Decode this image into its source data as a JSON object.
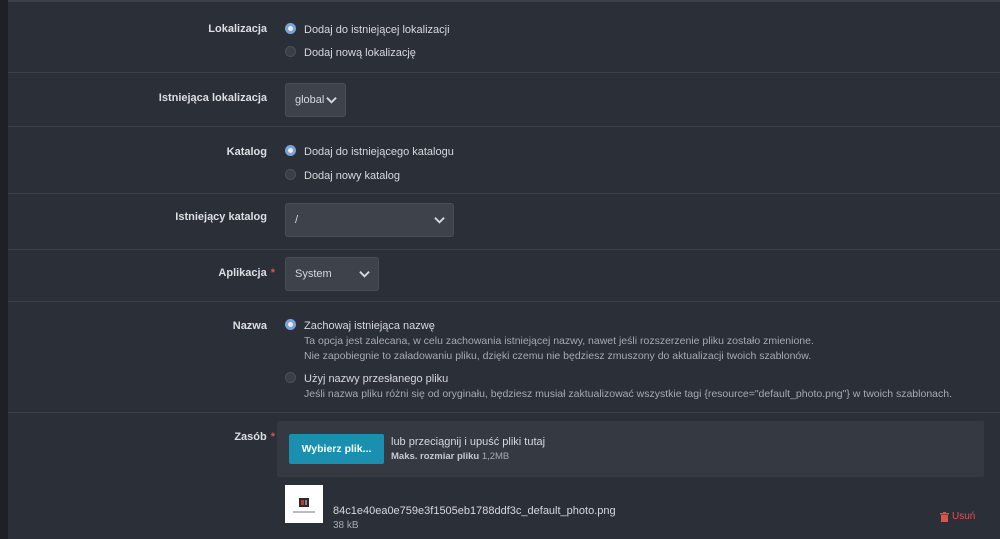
{
  "lokalizacja": {
    "label": "Lokalizacja",
    "options": [
      {
        "label": "Dodaj do istniejącej lokalizacji",
        "selected": true
      },
      {
        "label": "Dodaj nową lokalizację",
        "selected": false
      }
    ]
  },
  "istniejaca_lokalizacja": {
    "label": "Istniejąca lokalizacja",
    "value": "global"
  },
  "katalog": {
    "label": "Katalog",
    "options": [
      {
        "label": "Dodaj do istniejącego katalogu",
        "selected": true
      },
      {
        "label": "Dodaj nowy katalog",
        "selected": false
      }
    ]
  },
  "istniejacy_katalog": {
    "label": "Istniejący katalog",
    "value": "/"
  },
  "aplikacja": {
    "label": "Aplikacja",
    "required_mark": "*",
    "value": "System"
  },
  "nazwa": {
    "label": "Nazwa",
    "options": [
      {
        "label": "Zachowaj istniejąca nazwę",
        "desc1": "Ta opcja jest zalecana, w celu zachowania istniejącej nazwy, nawet jeśli rozszerzenie pliku zostało zmienione.",
        "desc2": "Nie zapobiegnie to załadowaniu pliku, dzięki czemu nie będziesz zmuszony do aktualizacji twoich szablonów.",
        "selected": true
      },
      {
        "label": "Użyj nazwy przesłanego pliku",
        "desc1": "Jeśli nazwa pliku różni się od oryginału, będziesz musiał zaktualizować wszystkie tagi {resource=\"default_photo.png\"} w twoich szablonach.",
        "selected": false
      }
    ]
  },
  "zasob": {
    "label": "Zasób",
    "required_mark": "*",
    "choose_button": "Wybierz plik...",
    "drop_text": "lub przeciągnij i upuść pliki tutaj",
    "max_size_label": "Maks. rozmiar pliku",
    "max_size_value": "1,2MB",
    "file": {
      "name": "84c1e40ea0e759e3f1505eb1788ddf3c_default_photo.png",
      "size": "38 kB",
      "remove_label": "Usuń"
    }
  },
  "colors": {
    "accent_button": "#1b8fb0",
    "danger": "#d9534f",
    "panel": "#2b2f37"
  }
}
